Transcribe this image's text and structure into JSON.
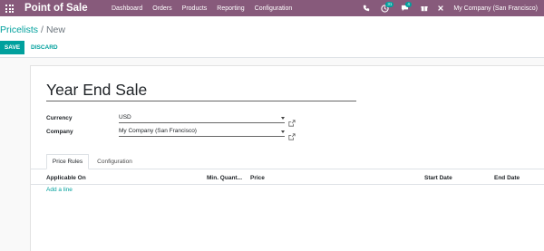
{
  "navbar": {
    "app_name": "Point of Sale",
    "menu": [
      "Dashboard",
      "Orders",
      "Products",
      "Reporting",
      "Configuration"
    ],
    "activity_count": "31",
    "message_count": "4",
    "company": "My Company (San Francisco)"
  },
  "breadcrumb": {
    "parent": "Pricelists",
    "separator": "/",
    "current": "New"
  },
  "buttons": {
    "save": "SAVE",
    "discard": "DISCARD"
  },
  "form": {
    "name": "Year End Sale",
    "currency_label": "Currency",
    "currency_value": "USD",
    "company_label": "Company",
    "company_value": "My Company (San Francisco)"
  },
  "tabs": [
    "Price Rules",
    "Configuration"
  ],
  "table": {
    "headers": [
      "Applicable On",
      "Min. Quant...",
      "Price",
      "Start Date",
      "End Date"
    ],
    "add_line": "Add a line"
  },
  "colors": {
    "brand": "#875a7b",
    "accent": "#00a09d"
  }
}
